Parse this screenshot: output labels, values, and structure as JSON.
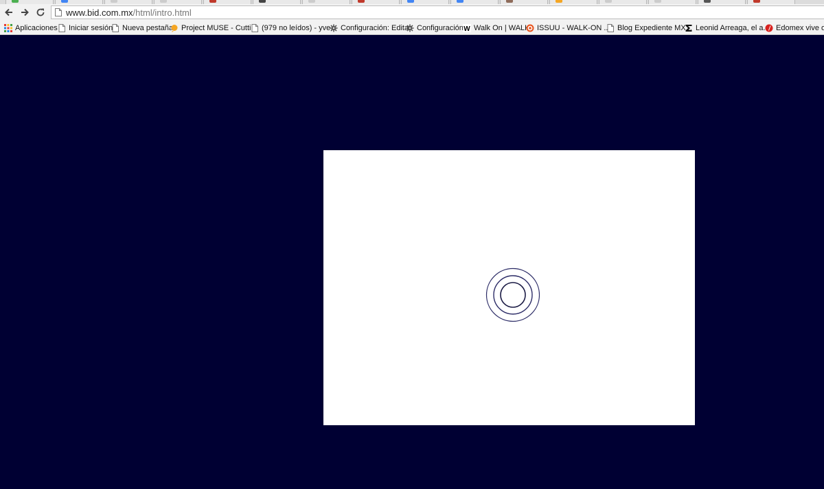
{
  "browser": {
    "url_host": "www.bid.com.mx",
    "url_path": "/html/intro.html",
    "tab_favicon_colors": [
      "#4caf50",
      "#4285f4",
      "#cccccc",
      "#cccccc",
      "#c0392b",
      "#444444",
      "#cccccc",
      "#c0392b",
      "#4285f4",
      "#4285f4",
      "#8e6b5a",
      "#f5a623",
      "#cccccc",
      "#cccccc",
      "#555555",
      "#c0392b"
    ]
  },
  "bookmarks": [
    {
      "label": "Aplicaciones",
      "icon": "apps-grid-icon"
    },
    {
      "label": "Iniciar sesión",
      "icon": "page-icon"
    },
    {
      "label": "Nueva pestaña",
      "icon": "page-icon"
    },
    {
      "label": "Project MUSE - Cutti...",
      "icon": "muse-icon"
    },
    {
      "label": "(979 no leídos) - yve...",
      "icon": "page-icon"
    },
    {
      "label": "Configuración: Editar",
      "icon": "gear-icon"
    },
    {
      "label": "Configuración",
      "icon": "gear-icon"
    },
    {
      "label": "Walk On | WALK",
      "icon": "walk-w-icon"
    },
    {
      "label": "ISSUU - WALK-ON ...",
      "icon": "issuu-icon"
    },
    {
      "label": "Blog Expediente MX...",
      "icon": "page-icon"
    },
    {
      "label": "Leonid Arreaga, el a...",
      "icon": "sigma-icon"
    },
    {
      "label": "Edomex vive ola d",
      "icon": "edomex-icon"
    }
  ],
  "page": {
    "background_color": "#000033",
    "stage_color": "#ffffff",
    "ring_color": "#2b2b66"
  }
}
